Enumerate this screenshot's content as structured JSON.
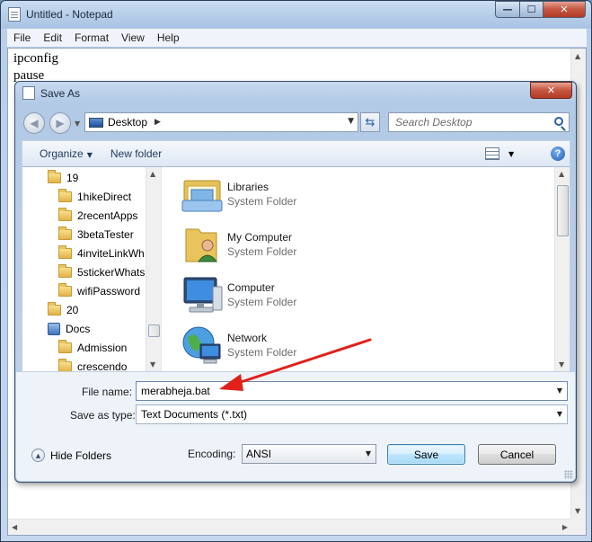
{
  "notepad": {
    "title": "Untitled - Notepad",
    "window_controls": {
      "minimize": "—",
      "maximize": "☐",
      "close": "✕"
    },
    "menu": [
      "File",
      "Edit",
      "Format",
      "View",
      "Help"
    ],
    "lines": [
      "ipconfig",
      "pause"
    ]
  },
  "dialog": {
    "title": "Save As",
    "close": "✕",
    "address": {
      "location": "Desktop"
    },
    "search": {
      "placeholder": "Search Desktop"
    },
    "toolbar": {
      "organize": "Organize",
      "new_folder": "New folder",
      "help": "?"
    },
    "tree": [
      {
        "label": "19",
        "icon": "folder-icon"
      },
      {
        "label": "1hikeDirect",
        "icon": "folder-icon"
      },
      {
        "label": "2recentApps",
        "icon": "folder-icon"
      },
      {
        "label": "3betaTester",
        "icon": "folder-icon"
      },
      {
        "label": "4inviteLinkWh",
        "icon": "folder-icon"
      },
      {
        "label": "5stickerWhats",
        "icon": "folder-icon"
      },
      {
        "label": "wifiPassword",
        "icon": "folder-icon"
      },
      {
        "label": "20",
        "icon": "folder-icon"
      },
      {
        "label": "Docs",
        "icon": "library-icon"
      },
      {
        "label": "Admission",
        "icon": "folder-icon"
      },
      {
        "label": "crescendo",
        "icon": "folder-icon"
      }
    ],
    "items": [
      {
        "name": "Libraries",
        "type": "System Folder",
        "icon": "libraries-icon"
      },
      {
        "name": "My Computer",
        "type": "System Folder",
        "icon": "user-folder-icon"
      },
      {
        "name": "Computer",
        "type": "System Folder",
        "icon": "computer-icon"
      },
      {
        "name": "Network",
        "type": "System Folder",
        "icon": "network-icon"
      }
    ],
    "form": {
      "file_name_label": "File name:",
      "file_name_value": "merabheja.bat",
      "save_type_label": "Save as type:",
      "save_type_value": "Text Documents (*.txt)",
      "encoding_label": "Encoding:",
      "encoding_value": "ANSI",
      "hide_folders": "Hide Folders",
      "save": "Save",
      "cancel": "Cancel"
    }
  },
  "annotation": {
    "arrow_color": "#e0201a"
  }
}
